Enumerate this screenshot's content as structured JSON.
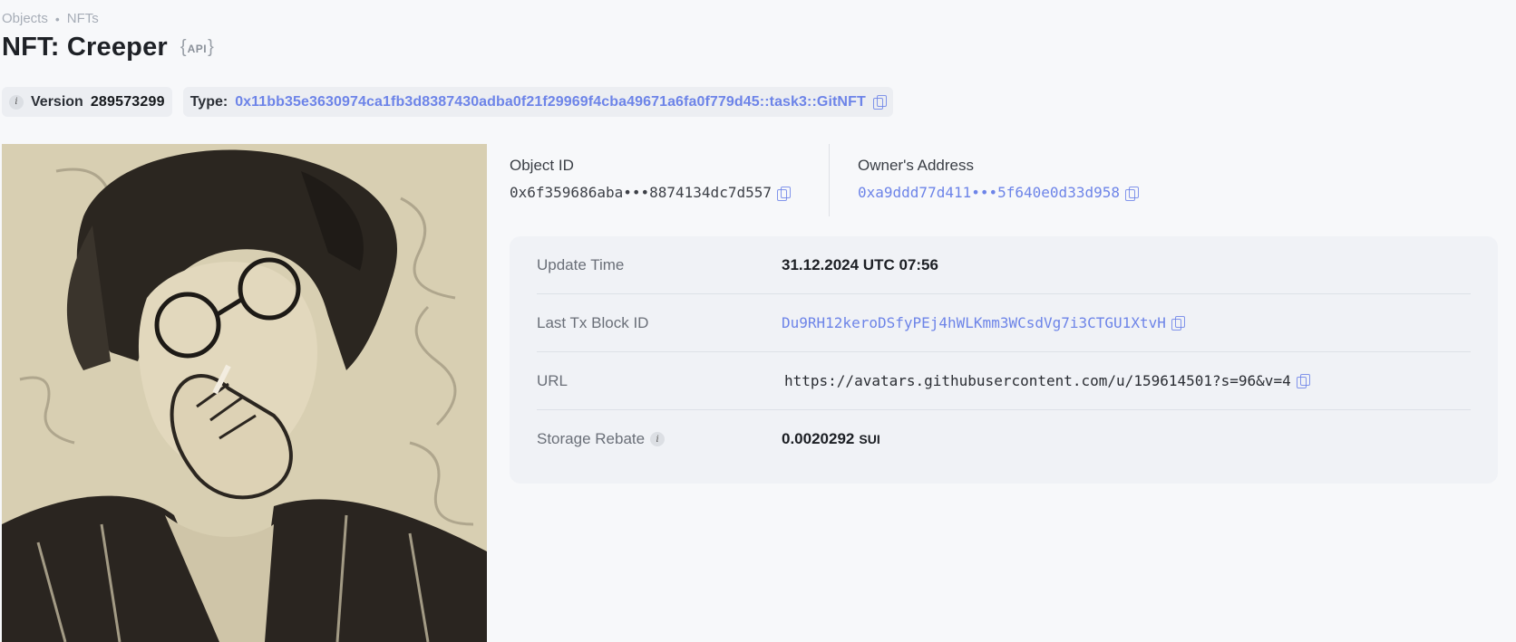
{
  "breadcrumb": {
    "items": [
      "Objects",
      "NFTs"
    ],
    "separator": "•"
  },
  "header": {
    "title": "NFT: Creeper",
    "api_badge": "API",
    "api_brace_open": "{",
    "api_brace_close": "}"
  },
  "pills": {
    "version_label": "Version",
    "version_value": "289573299",
    "info_glyph": "i",
    "type_label": "Type:",
    "type_value": "0x11bb35e3630974ca1fb3d8387430adba0f21f29969f4cba49671a6fa0f779d45::task3::GitNFT"
  },
  "ids": {
    "object_id_label": "Object ID",
    "object_id_value": "0x6f359686aba•••8874134dc7d557",
    "owner_label": "Owner's Address",
    "owner_value": "0xa9ddd77d411•••5f640e0d33d958"
  },
  "details": {
    "rows": [
      {
        "key": "Update Time",
        "value": "31.12.2024 UTC 07:56"
      },
      {
        "key": "Last Tx Block ID",
        "value": "Du9RH12keroDSfyPEj4hWLKmm3WCsdVg7i3CTGU1XtvH"
      },
      {
        "key": "URL",
        "value": "https://avatars.githubusercontent.com/u/159614501?s=96&v=4"
      },
      {
        "key": "Storage Rebate",
        "value": "0.0020292",
        "unit": "SUI",
        "info_glyph": "i"
      }
    ]
  },
  "colors": {
    "link": "#6d84e8",
    "background": "#f7f8fa",
    "card": "#f0f2f6",
    "pill": "#eceef2"
  },
  "icons": [
    "info-icon",
    "copy-icon"
  ]
}
